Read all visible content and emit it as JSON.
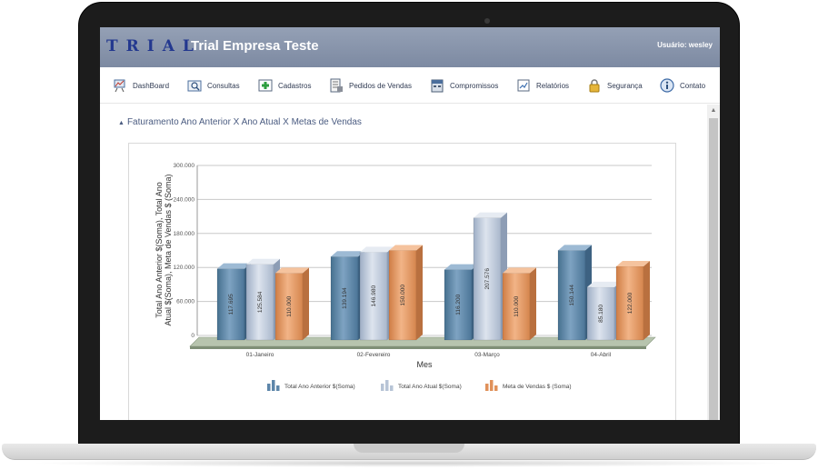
{
  "header": {
    "brand_mark": "TRIAL",
    "brand_name": "Trial Empresa Teste",
    "user": "Usuário: wesley"
  },
  "menu": [
    {
      "label": "DashBoard",
      "icon": "dashboard-icon"
    },
    {
      "label": "Consultas",
      "icon": "search-document-icon"
    },
    {
      "label": "Cadastros",
      "icon": "add-icon"
    },
    {
      "label": "Pedidos de Vendas",
      "icon": "sales-orders-icon"
    },
    {
      "label": "Compromissos",
      "icon": "calendar-icon"
    },
    {
      "label": "Relatórios",
      "icon": "reports-icon"
    },
    {
      "label": "Segurança",
      "icon": "lock-icon"
    },
    {
      "label": "Contato",
      "icon": "info-icon"
    }
  ],
  "section": {
    "title": "Faturamento Ano Anterior X Ano Atual X Metas de Vendas"
  },
  "colors": {
    "prev_year": "#5d86aa",
    "curr_year": "#b7c4d6",
    "target": "#e0915a",
    "header": "#8592a9",
    "brand": "#23388f"
  },
  "chart_data": {
    "type": "bar",
    "xlabel": "Mes",
    "ylabel": "Total Ano Anterior $(Soma), Total Ano Atual $(Soma), Meta de Vendas $ (Soma)",
    "ylim": [
      0,
      300000
    ],
    "y_ticks": [
      "0",
      "60.000",
      "120.000",
      "180.000",
      "240.000",
      "300.000"
    ],
    "categories": [
      "01-Janeiro",
      "02-Fevereiro",
      "03-Março",
      "04-Abril"
    ],
    "series": [
      {
        "name": "Total Ano Anterior $(Soma)",
        "values": [
          117695,
          139194,
          116200,
          150144
        ],
        "labels": [
          "117.695",
          "139.194",
          "116.200",
          "150.144"
        ]
      },
      {
        "name": "Total Ano Atual $(Soma)",
        "values": [
          125584,
          146980,
          207576,
          85180
        ],
        "labels": [
          "125.584",
          "146.980",
          "207.576",
          "85.180"
        ]
      },
      {
        "name": "Meta de Vendas $ (Soma)",
        "values": [
          110000,
          150000,
          110000,
          122000
        ],
        "labels": [
          "110.000",
          "150.000",
          "110.000",
          "122.000"
        ]
      }
    ],
    "legend": "bottom",
    "grid": true
  }
}
